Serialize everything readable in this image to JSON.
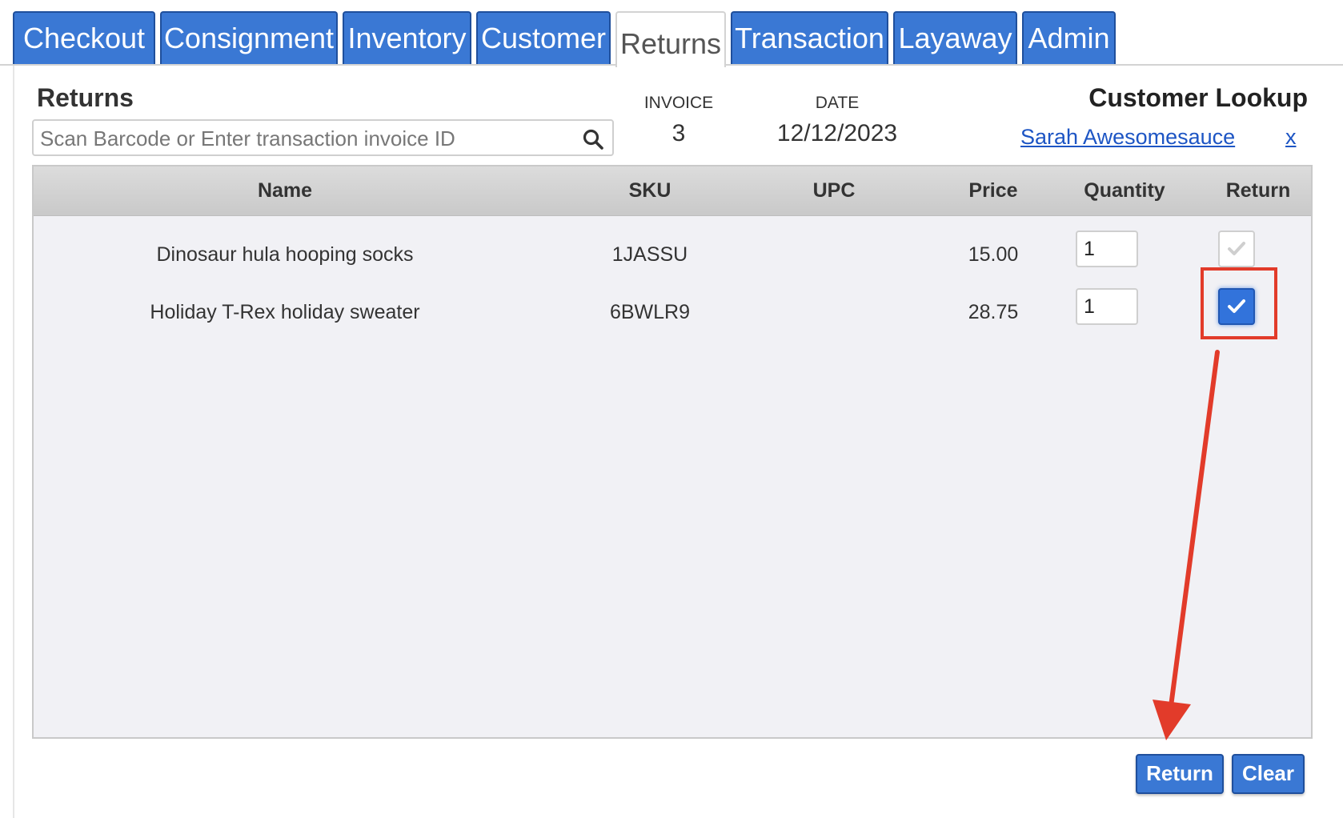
{
  "tabs": [
    {
      "label": "Checkout"
    },
    {
      "label": "Consignment"
    },
    {
      "label": "Inventory"
    },
    {
      "label": "Customer"
    },
    {
      "label": "Returns",
      "active": true
    },
    {
      "label": "Transaction"
    },
    {
      "label": "Layaway"
    },
    {
      "label": "Admin"
    }
  ],
  "returns": {
    "heading": "Returns",
    "search_placeholder": "Scan Barcode or Enter transaction invoice ID",
    "search_value": ""
  },
  "invoice": {
    "label": "INVOICE",
    "value": "3"
  },
  "date": {
    "label": "DATE",
    "value": "12/12/2023"
  },
  "customer": {
    "heading": "Customer Lookup",
    "name": "Sarah Awesomesauce",
    "clear_label": "x"
  },
  "table": {
    "columns": [
      "Name",
      "SKU",
      "UPC",
      "Price",
      "Quantity",
      "Return"
    ],
    "rows": [
      {
        "name": "Dinosaur hula hooping socks",
        "sku": "1JASSU",
        "upc": "",
        "price": "15.00",
        "quantity": "1",
        "return_checked": false
      },
      {
        "name": "Holiday T-Rex holiday sweater",
        "sku": "6BWLR9",
        "upc": "",
        "price": "28.75",
        "quantity": "1",
        "return_checked": true
      }
    ]
  },
  "actions": {
    "return_label": "Return",
    "clear_label": "Clear"
  },
  "colors": {
    "tab_blue": "#3a78d4",
    "link_blue": "#1d55c4",
    "annotation_red": "#e23b2a",
    "checkbox_checked": "#3273db"
  },
  "icons": {
    "search": "search-icon",
    "check": "check-icon"
  }
}
